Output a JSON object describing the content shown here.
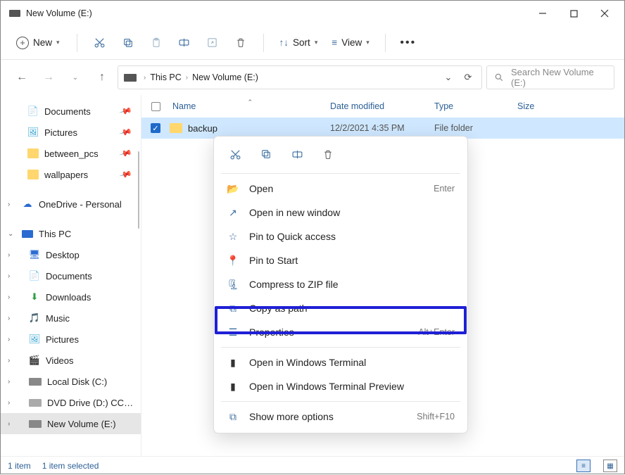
{
  "window": {
    "title": "New Volume (E:)"
  },
  "toolbar": {
    "new_label": "New",
    "sort_label": "Sort",
    "view_label": "View"
  },
  "breadcrumb": {
    "root": "This PC",
    "current": "New Volume (E:)"
  },
  "search": {
    "placeholder": "Search New Volume (E:)"
  },
  "nav": {
    "quick": [
      {
        "label": "Documents"
      },
      {
        "label": "Pictures"
      },
      {
        "label": "between_pcs"
      },
      {
        "label": "wallpapers"
      }
    ],
    "onedrive": "OneDrive - Personal",
    "thispc": "This PC",
    "pc_children": [
      {
        "label": "Desktop"
      },
      {
        "label": "Documents"
      },
      {
        "label": "Downloads"
      },
      {
        "label": "Music"
      },
      {
        "label": "Pictures"
      },
      {
        "label": "Videos"
      },
      {
        "label": "Local Disk (C:)"
      },
      {
        "label": "DVD Drive (D:) CCCOM…"
      },
      {
        "label": "New Volume (E:)"
      }
    ]
  },
  "columns": {
    "name": "Name",
    "date": "Date modified",
    "type": "Type",
    "size": "Size"
  },
  "rows": [
    {
      "name": "backup",
      "date": "12/2/2021 4:35 PM",
      "type": "File folder"
    }
  ],
  "context_menu": {
    "open": "Open",
    "open_short": "Enter",
    "open_new": "Open in new window",
    "pin_qa": "Pin to Quick access",
    "pin_start": "Pin to Start",
    "compress": "Compress to ZIP file",
    "copy_path": "Copy as path",
    "properties": "Properties",
    "properties_short": "Alt+Enter",
    "terminal": "Open in Windows Terminal",
    "terminal_preview": "Open in Windows Terminal Preview",
    "more": "Show more options",
    "more_short": "Shift+F10"
  },
  "status": {
    "count": "1 item",
    "selected": "1 item selected"
  }
}
